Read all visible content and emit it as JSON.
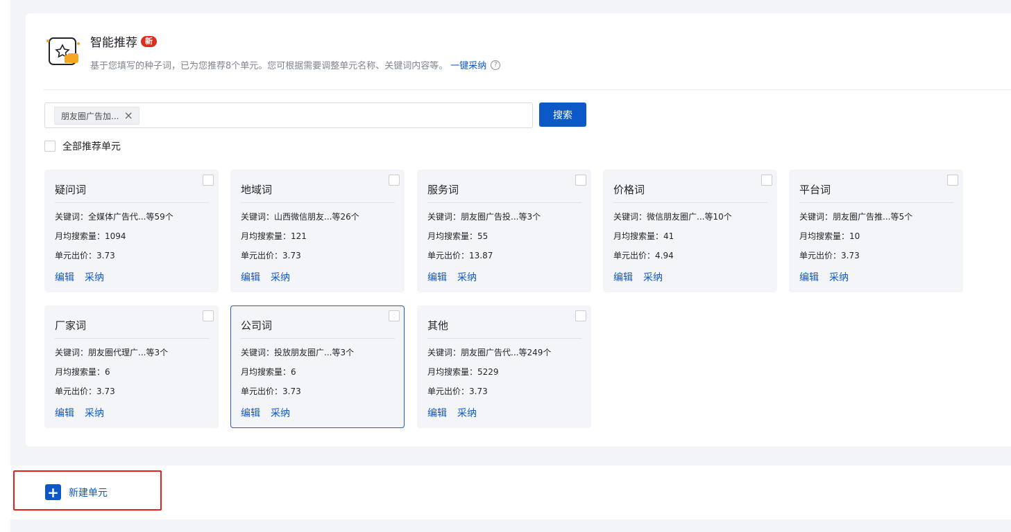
{
  "header": {
    "title": "智能推荐",
    "badge": "新",
    "description": "基于您填写的种子词，已为您推荐8个单元。您可根据需要调整单元名称、关键词内容等。",
    "adopt_all_link": "一键采纳",
    "help_icon": "question-circle-icon"
  },
  "search": {
    "tag": "朋友圈广告加...",
    "button": "搜索"
  },
  "select_all_label": "全部推荐单元",
  "cards": [
    {
      "title": "疑问词",
      "keywords": "关键词：全媒体广告代...等59个",
      "volume": "月均搜索量：1094",
      "bid": "单元出价：3.73",
      "edit": "编辑",
      "adopt": "采纳"
    },
    {
      "title": "地域词",
      "keywords": "关键词：山西微信朋友...等26个",
      "volume": "月均搜索量：121",
      "bid": "单元出价：3.73",
      "edit": "编辑",
      "adopt": "采纳"
    },
    {
      "title": "服务词",
      "keywords": "关键词：朋友圈广告投...等3个",
      "volume": "月均搜索量：55",
      "bid": "单元出价：13.87",
      "edit": "编辑",
      "adopt": "采纳"
    },
    {
      "title": "价格词",
      "keywords": "关键词：微信朋友圈广...等10个",
      "volume": "月均搜索量：41",
      "bid": "单元出价：4.94",
      "edit": "编辑",
      "adopt": "采纳"
    },
    {
      "title": "平台词",
      "keywords": "关键词：朋友圈广告推...等5个",
      "volume": "月均搜索量：10",
      "bid": "单元出价：3.73",
      "edit": "编辑",
      "adopt": "采纳"
    },
    {
      "title": "厂家词",
      "keywords": "关键词：朋友圈代理广...等3个",
      "volume": "月均搜索量：6",
      "bid": "单元出价：3.73",
      "edit": "编辑",
      "adopt": "采纳"
    },
    {
      "title": "公司词",
      "keywords": "关键词：投放朋友圈广...等3个",
      "volume": "月均搜索量：6",
      "bid": "单元出价：3.73",
      "edit": "编辑",
      "adopt": "采纳"
    },
    {
      "title": "其他",
      "keywords": "关键词：朋友圈广告代...等249个",
      "volume": "月均搜索量：5229",
      "bid": "单元出价：3.73",
      "edit": "编辑",
      "adopt": "采纳"
    }
  ],
  "new_unit": {
    "label": "新建单元",
    "icon": "plus-icon"
  },
  "colors": {
    "accent": "#0d58c7",
    "badge": "#d8301f",
    "highlight": "#e5201d"
  }
}
